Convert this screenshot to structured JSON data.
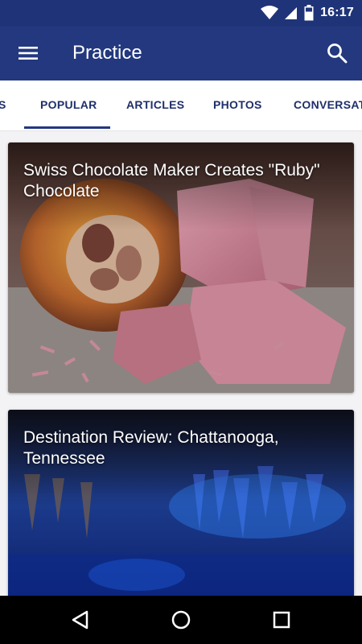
{
  "status_bar": {
    "time": "16:17",
    "icons": [
      "wifi-icon",
      "signal-icon",
      "battery-icon"
    ]
  },
  "app_bar": {
    "title": "Practice",
    "menu_icon": "hamburger-menu-icon",
    "search_icon": "search-icon",
    "color": "#23387e"
  },
  "tabs": [
    {
      "label": "S",
      "selected": false
    },
    {
      "label": "POPULAR",
      "selected": true
    },
    {
      "label": "ARTICLES",
      "selected": false
    },
    {
      "label": "PHOTOS",
      "selected": false
    },
    {
      "label": "CONVERSATI",
      "selected": false
    }
  ],
  "cards": [
    {
      "title": "Swiss Chocolate Maker Creates \"Ruby\" Chocolate"
    },
    {
      "title": "Destination Review: Chattanooga, Tennessee"
    }
  ],
  "nav_bar": {
    "icons": [
      "back-icon",
      "home-icon",
      "recents-icon"
    ]
  }
}
